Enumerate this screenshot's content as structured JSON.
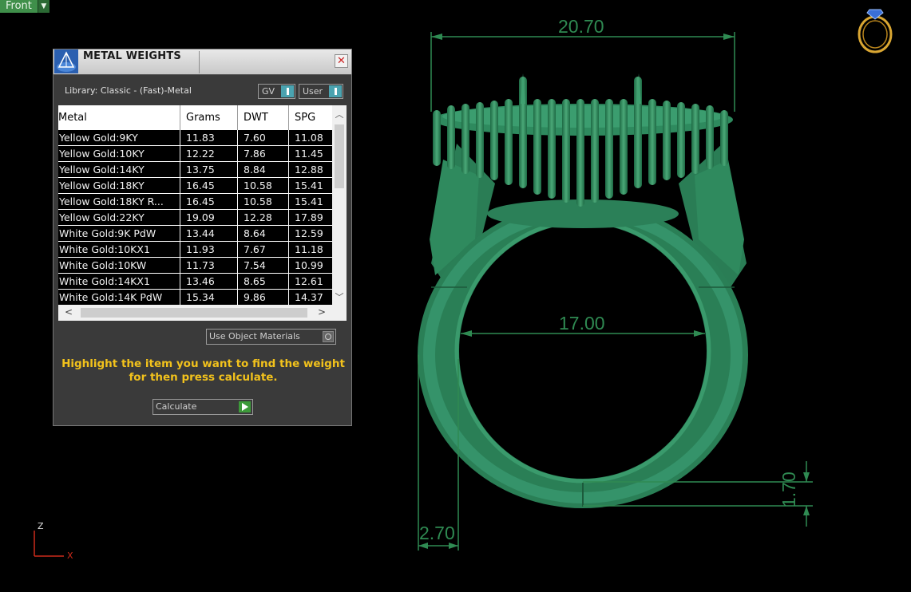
{
  "viewport": {
    "label": "Front"
  },
  "panel": {
    "title": "METAL WEIGHTS",
    "library": "Library: Classic - (Fast)-Metal",
    "toggle_gv": "GV",
    "toggle_user": "User",
    "columns": [
      "Metal",
      "Grams",
      "DWT",
      "SPG"
    ],
    "rows": [
      [
        "Yellow Gold:9KY",
        "11.83",
        "7.60",
        "11.08"
      ],
      [
        "Yellow Gold:10KY",
        "12.22",
        "7.86",
        "11.45"
      ],
      [
        "Yellow Gold:14KY",
        "13.75",
        "8.84",
        "12.88"
      ],
      [
        "Yellow Gold:18KY",
        "16.45",
        "10.58",
        "15.41"
      ],
      [
        "Yellow Gold:18KY R...",
        "16.45",
        "10.58",
        "15.41"
      ],
      [
        "Yellow Gold:22KY",
        "19.09",
        "12.28",
        "17.89"
      ],
      [
        "White Gold:9K PdW",
        "13.44",
        "8.64",
        "12.59"
      ],
      [
        "White Gold:10KX1",
        "11.93",
        "7.67",
        "11.18"
      ],
      [
        "White Gold:10KW",
        "11.73",
        "7.54",
        "10.99"
      ],
      [
        "White Gold:14KX1",
        "13.46",
        "8.65",
        "12.61"
      ],
      [
        "White Gold:14K PdW",
        "15.34",
        "9.86",
        "14.37"
      ]
    ],
    "use_object_materials": "Use Object Materials",
    "hint_line1": "Highlight the item you want to find the weight",
    "hint_line2": "for then press calculate.",
    "calculate_label": "Calculate"
  },
  "dimensions": {
    "top_width": "20.70",
    "inner_diameter": "17.00",
    "shank_width": "2.70",
    "shank_thickness": "1.70"
  },
  "axes": {
    "z": "Z",
    "x": "X"
  },
  "colors": {
    "model": "#2e8a5c",
    "dim": "#2f8a52",
    "hint": "#f2c21c",
    "label_bg": "#3f8f4a"
  }
}
